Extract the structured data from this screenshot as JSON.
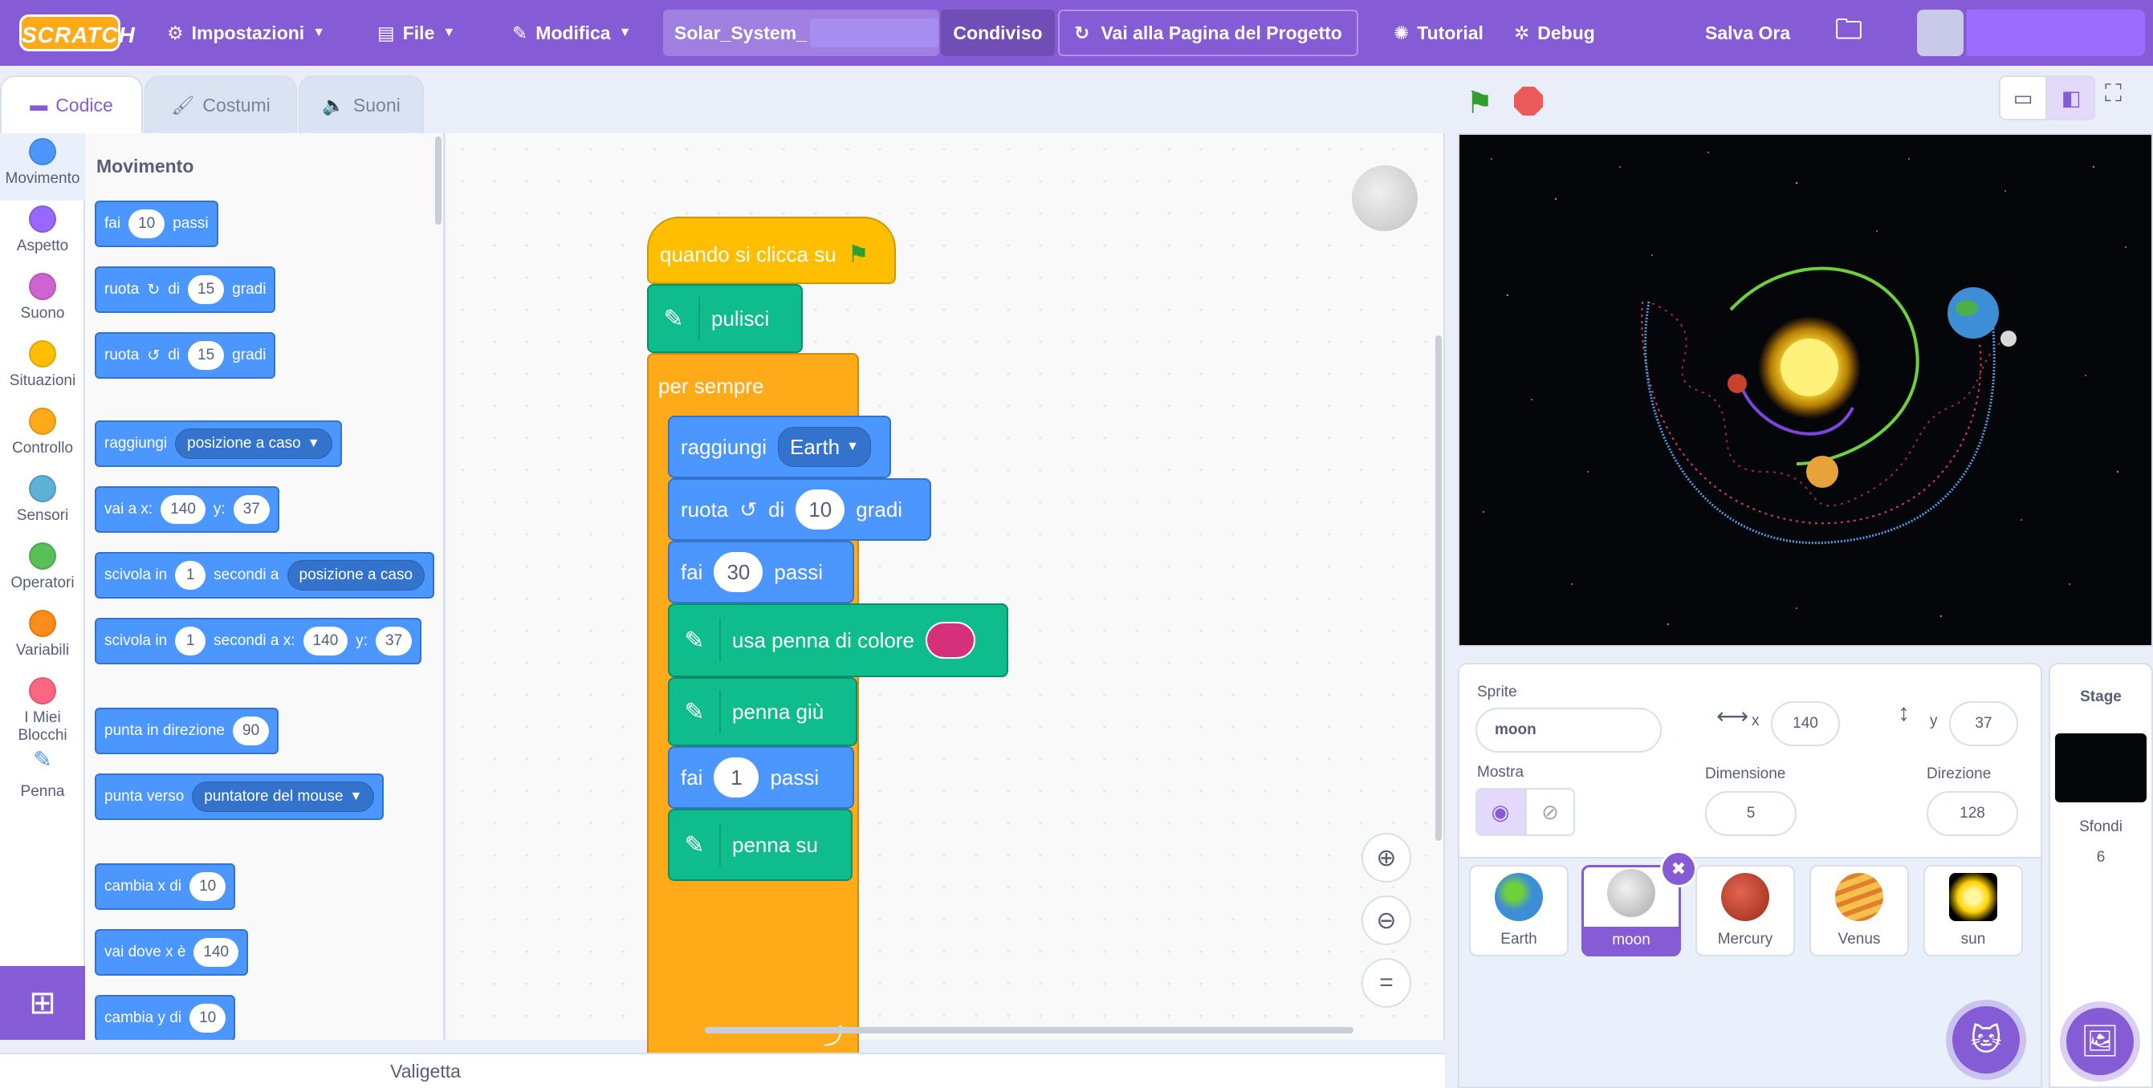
{
  "menubar": {
    "logo": "SCRATCH",
    "settings": "Impostazioni",
    "file": "File",
    "edit": "Modifica",
    "project_title": "Solar_System_",
    "shared": "Condiviso",
    "see_project": "Vai alla Pagina del Progetto",
    "tutorial": "Tutorial",
    "debug": "Debug",
    "save_now": "Salva Ora"
  },
  "tabs": {
    "code": "Codice",
    "costumes": "Costumi",
    "sounds": "Suoni"
  },
  "categories": [
    {
      "label": "Movimento",
      "color": "#4c97ff"
    },
    {
      "label": "Aspetto",
      "color": "#9966ff"
    },
    {
      "label": "Suono",
      "color": "#cf63cf"
    },
    {
      "label": "Situazioni",
      "color": "#ffbf00"
    },
    {
      "label": "Controllo",
      "color": "#ffab19"
    },
    {
      "label": "Sensori",
      "color": "#5cb1d6"
    },
    {
      "label": "Operatori",
      "color": "#59c059"
    },
    {
      "label": "Variabili",
      "color": "#ff8c1a"
    },
    {
      "label": "I Miei Blocchi",
      "color": "#ff6680"
    },
    {
      "label": "Penna",
      "color": "#0fbd8c"
    }
  ],
  "palette": {
    "title": "Movimento",
    "move": {
      "a": "fai",
      "v": "10",
      "b": "passi"
    },
    "turn_right": {
      "a": "ruota",
      "b": "di",
      "v": "15",
      "c": "gradi"
    },
    "turn_left": {
      "a": "ruota",
      "b": "di",
      "v": "15",
      "c": "gradi"
    },
    "goto": {
      "a": "raggiungi",
      "d": "posizione a caso"
    },
    "gotoxy": {
      "a": "vai a x:",
      "x": "140",
      "b": "y:",
      "y": "37"
    },
    "glide": {
      "a": "scivola in",
      "v": "1",
      "b": "secondi a",
      "d": "posizione a caso"
    },
    "glidexy": {
      "a": "scivola in",
      "v": "1",
      "b": "secondi a x:",
      "x": "140",
      "c": "y:",
      "y": "37"
    },
    "point_dir": {
      "a": "punta in direzione",
      "v": "90"
    },
    "point_to": {
      "a": "punta verso",
      "d": "puntatore del mouse"
    },
    "change_x": {
      "a": "cambia x di",
      "v": "10"
    },
    "set_x": {
      "a": "vai dove x è",
      "v": "140"
    },
    "change_y": {
      "a": "cambia y di",
      "v": "10"
    }
  },
  "script": {
    "hat": "quando si clicca su",
    "clear": "pulisci",
    "forever": "per sempre",
    "goto": {
      "a": "raggiungi",
      "d": "Earth"
    },
    "turn": {
      "a": "ruota",
      "b": "di",
      "v": "10",
      "c": "gradi"
    },
    "move1": {
      "a": "fai",
      "v": "30",
      "b": "passi"
    },
    "pen_color": {
      "a": "usa penna di colore",
      "color": "#d6307a"
    },
    "pen_down": "penna giù",
    "move2": {
      "a": "fai",
      "v": "1",
      "b": "passi"
    },
    "pen_up": "penna su"
  },
  "sprite_info": {
    "sprite_label": "Sprite",
    "sprite_name": "moon",
    "x_label": "x",
    "x": "140",
    "y_label": "y",
    "y": "37",
    "show_label": "Mostra",
    "size_label": "Dimensione",
    "size": "5",
    "direction_label": "Direzione",
    "direction": "128"
  },
  "sprites": [
    {
      "name": "Earth",
      "color": "#3d8ed6"
    },
    {
      "name": "moon",
      "color": "#cfcfcf"
    },
    {
      "name": "Mercury",
      "color": "#c9422b"
    },
    {
      "name": "Venus",
      "color": "#e8a23a"
    },
    {
      "name": "sun",
      "color": "#ffe23a"
    }
  ],
  "stage_pane": {
    "title": "Stage",
    "backdrops_label": "Sfondi",
    "backdrops_count": "6"
  },
  "backpack": "Valigetta"
}
